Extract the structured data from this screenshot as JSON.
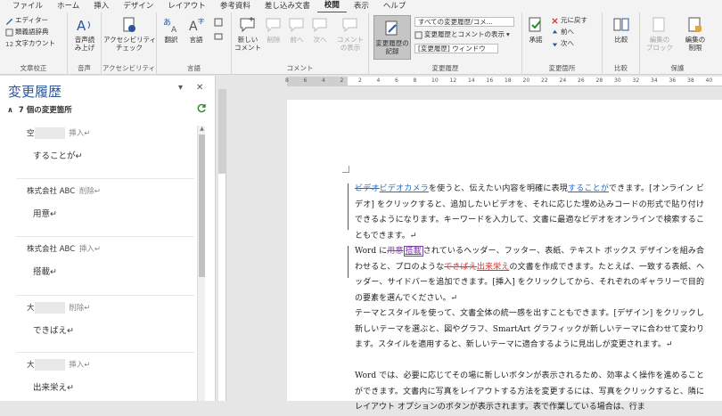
{
  "tabs": [
    "ファイル",
    "ホーム",
    "挿入",
    "デザイン",
    "レイアウト",
    "参考資料",
    "差し込み文書",
    "校閲",
    "表示",
    "ヘルプ"
  ],
  "active_tab": "校閲",
  "ribbon": {
    "proof": {
      "editor": "エディター",
      "thesaurus": "類義語辞典",
      "wordcount": "文字カウント",
      "label": "文章校正"
    },
    "speech": {
      "read_aloud_1": "音声読",
      "read_aloud_2": "み上げ",
      "label": "音声"
    },
    "access": {
      "check_1": "アクセシビリティ",
      "check_2": "チェック",
      "label": "アクセシビリティ"
    },
    "lang": {
      "translate": "翻訳",
      "language": "言語",
      "label": "言語"
    },
    "comment": {
      "new_1": "新しい",
      "new_2": "コメント",
      "delete": "削除",
      "prev": "前へ",
      "next": "次へ",
      "show_1": "コメント",
      "show_2": "の表示",
      "label": "コメント"
    },
    "track": {
      "record_1": "変更履歴の",
      "record_2": "記録",
      "markup_dd": "すべての変更履歴/コメ...",
      "show_markup": "変更履歴とコメントの表示",
      "pane_dd": "[変更履歴] ウィンドウ",
      "label": "変更履歴"
    },
    "changes": {
      "accept": "承諾",
      "undo": "元に戻す",
      "prev": "前へ",
      "next": "次へ",
      "label": "変更箇所"
    },
    "compare": {
      "compare": "比較",
      "label": "比較"
    },
    "protect": {
      "block_1": "編集の",
      "block_2": "ブロック",
      "restrict_1": "編集の",
      "restrict_2": "制限",
      "label": "保護"
    }
  },
  "pane": {
    "title": "変更履歴",
    "count": "7 個の変更箇所",
    "items": [
      {
        "author": "空",
        "action": "挿入↵",
        "text": "することが↵"
      },
      {
        "author": "株式会社 ABC",
        "action": "削除↵",
        "text": "用意↵"
      },
      {
        "author": "株式会社 ABC",
        "action": "挿入↵",
        "text": "搭載↵"
      },
      {
        "author": "大",
        "action": "削除↵",
        "text": "できばえ↵"
      },
      {
        "author": "大",
        "action": "挿入↵",
        "text": "出来栄え↵"
      }
    ]
  },
  "ruler": [
    "8",
    "6",
    "4",
    "2",
    "2",
    "4",
    "6",
    "8",
    "10",
    "12",
    "14",
    "16",
    "18",
    "20",
    "22",
    "24",
    "26",
    "28",
    "30",
    "32",
    "34",
    "36",
    "38",
    "40"
  ],
  "doc": {
    "p1": {
      "del": "ビデオ",
      "ins": "ビデオカメラ",
      "t1": "を使うと、伝えたい内容を明確に表現",
      "ins2": "することが",
      "t2": "できます。[オンライン ビデオ] をクリックすると、追加したいビデオを、それに応じた埋め込みコードの形式で貼り付けできるようになります。キーワードを入力して、文書に最適なビデオをオンラインで検索することもできます。↵"
    },
    "p2": {
      "t0": "Word に",
      "del": "用意",
      "ins": "搭載",
      "t1": "されているヘッダー、フッター、表紙、テキスト ボックス デザインを組み合わせると、プロのような",
      "del2": "できばえ",
      "ins2": "出来栄え",
      "t2": "の文書を作成できます。たとえば、一致する表紙、ヘッダー、サイドバーを追加できます。[挿入] をクリックしてから、それぞれのギャラリーで目的の要素を選んでください。↵"
    },
    "p3": "テーマとスタイルを使って、文書全体の統一感を出すこともできます。[デザイン] をクリックし新しいテーマを選ぶと、図やグラフ、SmartArt グラフィックが新しいテーマに合わせて変わります。スタイルを適用すると、新しいテーマに適合するように見出しが変更されます。↵",
    "p4": "Word では、必要に応じてその場に新しいボタンが表示されるため、効率よく操作を進めることができます。文書内に写真をレイアウトする方法を変更するには、写真をクリックすると、隣にレイアウト オプションのボタンが表示されます。表で作業している場合は、行ま"
  },
  "colors": {
    "accent": "#2b579a",
    "insert_blue": "#1f6fd1",
    "purple": "#7a3fa8",
    "red": "#d33"
  }
}
